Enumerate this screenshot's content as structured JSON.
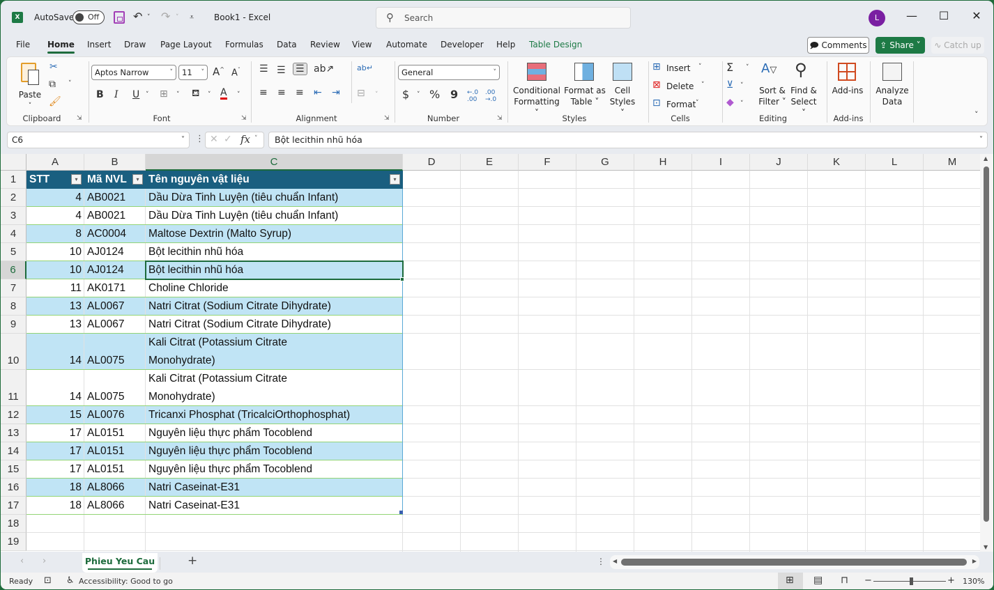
{
  "titlebar": {
    "autosave_label": "AutoSave",
    "autosave_state": "Off",
    "doc_title": "Book1  -  Excel",
    "search_placeholder": "Search",
    "avatar_initial": "L",
    "minimize": "—",
    "maximize": "☐",
    "close": "✕"
  },
  "menu_tabs": [
    "File",
    "Home",
    "Insert",
    "Draw",
    "Page Layout",
    "Formulas",
    "Data",
    "Review",
    "View",
    "Automate",
    "Developer",
    "Help",
    "Table Design"
  ],
  "active_tab": "Home",
  "header_buttons": {
    "comments": "Comments",
    "share": "Share",
    "catch_up": "Catch up"
  },
  "ribbon": {
    "clipboard": {
      "label": "Clipboard",
      "paste": "Paste"
    },
    "font": {
      "label": "Font",
      "font_name": "Aptos Narrow",
      "font_size": "11",
      "bold": "B",
      "italic": "I",
      "underline": "U"
    },
    "alignment": {
      "label": "Alignment"
    },
    "number": {
      "label": "Number",
      "format": "General",
      "currency": "$",
      "percent": "%",
      "comma": "9"
    },
    "styles": {
      "label": "Styles",
      "conditional_formatting": [
        "Conditional",
        "Formatting ˅"
      ],
      "format_as_table": [
        "Format as",
        "Table ˅"
      ],
      "cell_styles": [
        "Cell",
        "Styles ˅"
      ]
    },
    "cells": {
      "label": "Cells",
      "insert": "Insert",
      "delete": "Delete",
      "format": "Format"
    },
    "editing": {
      "label": "Editing",
      "sort_filter": [
        "Sort &",
        "Filter ˅"
      ],
      "find_select": [
        "Find &",
        "Select ˅"
      ]
    },
    "addins": {
      "label": "Add-ins",
      "addins": "Add-ins"
    },
    "analyze": {
      "analyze_data": [
        "Analyze",
        "Data"
      ]
    }
  },
  "formula_bar": {
    "name_box": "C6",
    "formula": "Bột lecithin nhũ hóa"
  },
  "columns": [
    "A",
    "B",
    "C",
    "D",
    "E",
    "F",
    "G",
    "H",
    "I",
    "J",
    "K",
    "L",
    "M"
  ],
  "selected_column": "C",
  "selected_row": 6,
  "table": {
    "headers": [
      "STT",
      "Mã NVL",
      "Tên nguyên vật liệu"
    ],
    "rows": [
      {
        "row": 2,
        "stt": "4",
        "ma": "AB0021",
        "ten": [
          "Dầu Dừa Tinh Luyện (tiêu chuẩn Infant)"
        ]
      },
      {
        "row": 3,
        "stt": "4",
        "ma": "AB0021",
        "ten": [
          "Dầu Dừa Tinh Luyện (tiêu chuẩn Infant)"
        ]
      },
      {
        "row": 4,
        "stt": "8",
        "ma": "AC0004",
        "ten": [
          "Maltose Dextrin (Malto Syrup)"
        ]
      },
      {
        "row": 5,
        "stt": "10",
        "ma": "AJ0124",
        "ten": [
          "Bột lecithin nhũ hóa"
        ]
      },
      {
        "row": 6,
        "stt": "10",
        "ma": "AJ0124",
        "ten": [
          "Bột lecithin nhũ hóa"
        ]
      },
      {
        "row": 7,
        "stt": "11",
        "ma": "AK0171",
        "ten": [
          "Choline Chloride"
        ]
      },
      {
        "row": 8,
        "stt": "13",
        "ma": "AL0067",
        "ten": [
          "Natri Citrat (Sodium Citrate Dihydrate)"
        ]
      },
      {
        "row": 9,
        "stt": "13",
        "ma": "AL0067",
        "ten": [
          "Natri Citrat (Sodium Citrate Dihydrate)"
        ]
      },
      {
        "row": 10,
        "stt": "14",
        "ma": "AL0075",
        "ten": [
          "Kali Citrat (Potassium Citrate",
          "Monohydrate)"
        ]
      },
      {
        "row": 11,
        "stt": "14",
        "ma": "AL0075",
        "ten": [
          "Kali Citrat (Potassium Citrate",
          "Monohydrate)"
        ]
      },
      {
        "row": 12,
        "stt": "15",
        "ma": "AL0076",
        "ten": [
          "Tricanxi Phosphat (TricalciOrthophosphat)"
        ]
      },
      {
        "row": 13,
        "stt": "17",
        "ma": "AL0151",
        "ten": [
          "Nguyên liệu thực phẩm Tocoblend"
        ]
      },
      {
        "row": 14,
        "stt": "17",
        "ma": "AL0151",
        "ten": [
          "Nguyên liệu thực phẩm Tocoblend"
        ]
      },
      {
        "row": 15,
        "stt": "17",
        "ma": "AL0151",
        "ten": [
          "Nguyên liệu thực phẩm Tocoblend"
        ]
      },
      {
        "row": 16,
        "stt": "18",
        "ma": "AL8066",
        "ten": [
          "Natri Caseinat-E31"
        ]
      },
      {
        "row": 17,
        "stt": "18",
        "ma": "AL8066",
        "ten": [
          "Natri Caseinat-E31"
        ]
      }
    ]
  },
  "empty_rows": [
    18,
    19
  ],
  "sheets": [
    "Phieu Yeu Cau"
  ],
  "status": {
    "ready": "Ready",
    "accessibility": "Accessibility: Good to go",
    "zoom": "130%",
    "zoom_minus": "−",
    "zoom_plus": "+"
  },
  "colors": {
    "brand_green": "#1d7a45",
    "table_header": "#1a5f80",
    "band_fill": "#c0e4f5"
  }
}
